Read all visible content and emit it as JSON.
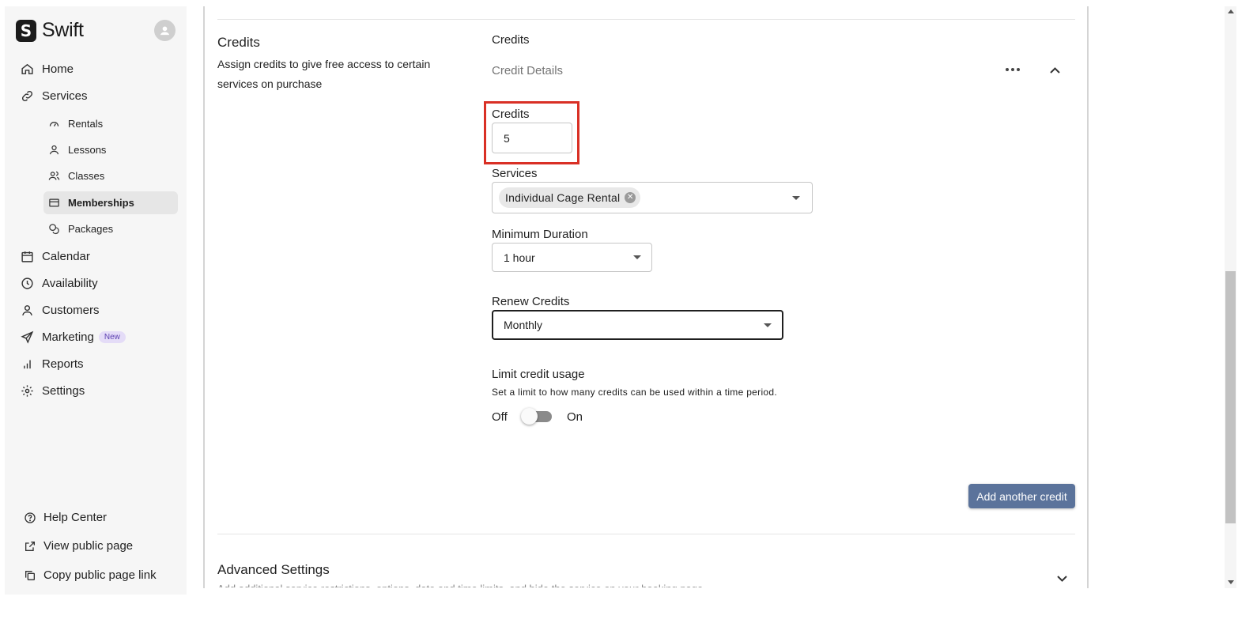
{
  "app": {
    "name": "Swift",
    "logo_letter": "S"
  },
  "sidebar": {
    "nav": [
      {
        "label": "Home",
        "icon": "home-icon"
      },
      {
        "label": "Services",
        "icon": "link-icon"
      },
      {
        "label": "Calendar",
        "icon": "calendar-icon"
      },
      {
        "label": "Availability",
        "icon": "clock-icon"
      },
      {
        "label": "Customers",
        "icon": "person-icon"
      },
      {
        "label": "Marketing",
        "icon": "send-icon",
        "badge": "New"
      },
      {
        "label": "Reports",
        "icon": "bar-chart-icon"
      },
      {
        "label": "Settings",
        "icon": "gear-icon"
      }
    ],
    "services_sub": [
      {
        "label": "Rentals",
        "icon": "gauge-icon"
      },
      {
        "label": "Lessons",
        "icon": "person-icon"
      },
      {
        "label": "Classes",
        "icon": "people-icon"
      },
      {
        "label": "Memberships",
        "icon": "card-icon",
        "active": true
      },
      {
        "label": "Packages",
        "icon": "coins-icon"
      }
    ],
    "footer": [
      {
        "label": "Help Center",
        "icon": "help-circle-icon"
      },
      {
        "label": "View public page",
        "icon": "external-link-icon"
      },
      {
        "label": "Copy public page link",
        "icon": "copy-icon"
      }
    ]
  },
  "section": {
    "title": "Credits",
    "description": "Assign credits to give free access to certain services on purchase",
    "subtitle": "Credits",
    "panel_title": "Credit Details"
  },
  "form": {
    "credits_label": "Credits",
    "credits_value": "5",
    "services_label": "Services",
    "services_selected": [
      "Individual Cage Rental"
    ],
    "min_duration_label": "Minimum Duration",
    "min_duration_value": "1 hour",
    "renew_label": "Renew Credits",
    "renew_value": "Monthly",
    "limit_label": "Limit credit usage",
    "limit_help": "Set a limit to how many credits can be used within a time period.",
    "toggle_off": "Off",
    "toggle_on": "On",
    "toggle_state": "off"
  },
  "actions": {
    "add_credit": "Add another credit"
  },
  "advanced": {
    "title": "Advanced Settings",
    "description": "Add additional service restrictions, options, date and time limits, and hide the service on your booking page."
  },
  "colors": {
    "primary_button": "#5b739b",
    "highlight": "#d93025",
    "badge_bg": "#e4dcf7",
    "badge_text": "#5b3fb0"
  }
}
